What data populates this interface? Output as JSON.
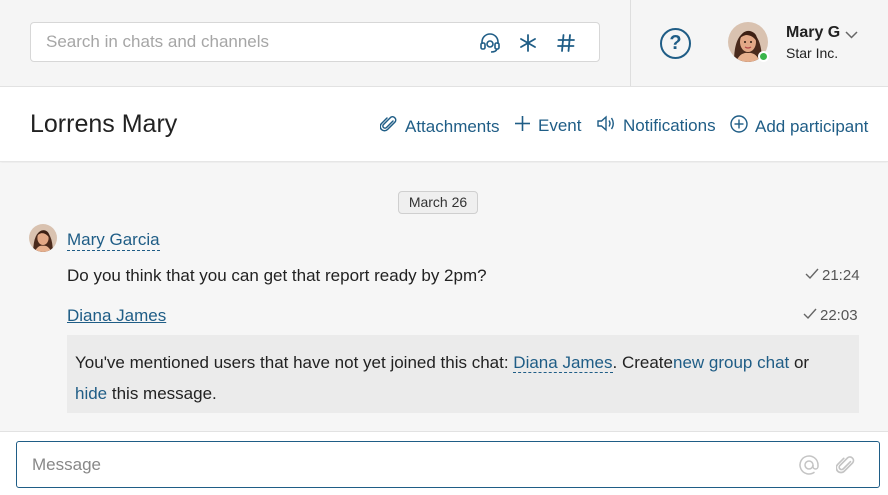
{
  "search": {
    "placeholder": "Search in chats and channels"
  },
  "search_icons": [
    "support-icon",
    "asterisk-icon",
    "hash-icon"
  ],
  "help": {
    "label": "?"
  },
  "user": {
    "name": "Mary G",
    "company": "Star Inc."
  },
  "chat": {
    "title": "Lorrens Mary"
  },
  "actions": {
    "attachments": "Attachments",
    "event": "Event",
    "notifications": "Notifications",
    "add_participant": "Add participant"
  },
  "feed": {
    "date": "March 26",
    "sender": "Mary Garcia",
    "message": "Do you think that you can get that report ready by 2pm?",
    "message_time": "21:24",
    "mention": "Diana James",
    "mention_time": "22:03",
    "system": {
      "part1": "You've mentioned users that have not yet joined this chat: ",
      "user": "Diana James",
      "part2": ".  Create",
      "group_link": "new group chat",
      "part3": " or",
      "hide_link": "hide",
      "part4": " this message."
    }
  },
  "composer": {
    "placeholder": "Message"
  },
  "colors": {
    "accent": "#1f5d86",
    "online": "#3ab54a"
  }
}
